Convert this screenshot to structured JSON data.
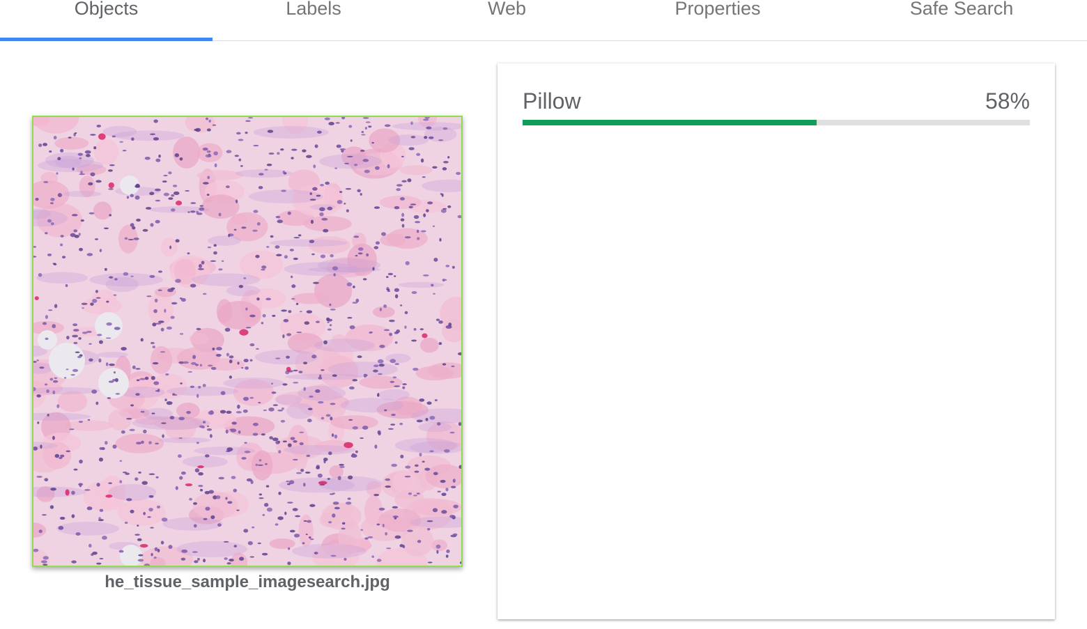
{
  "tabs": [
    {
      "label": "Objects",
      "active": true
    },
    {
      "label": "Labels",
      "active": false
    },
    {
      "label": "Web",
      "active": false
    },
    {
      "label": "Properties",
      "active": false
    },
    {
      "label": "Safe Search",
      "active": false
    }
  ],
  "image": {
    "filename": "he_tissue_sample_imagesearch.jpg",
    "detection_box_color": "#8fdc4c"
  },
  "results": [
    {
      "name": "Pillow",
      "score_label": "58%",
      "score": 0.58,
      "bar_color": "#0f9d58"
    }
  ],
  "colors": {
    "accent": "#4285f4",
    "text": "#5f6368",
    "muted_text": "#757575"
  }
}
